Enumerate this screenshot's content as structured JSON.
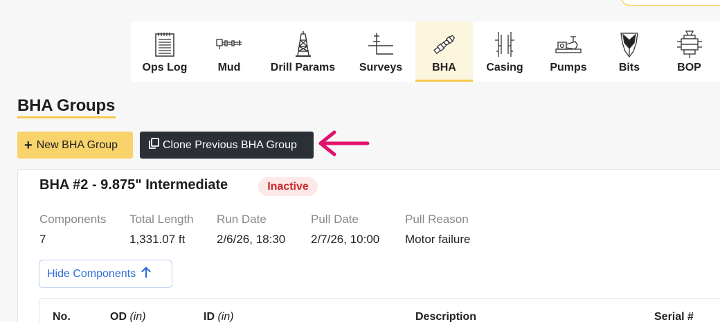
{
  "tabs": [
    {
      "label": "Ops Log",
      "icon": "ops-log-icon"
    },
    {
      "label": "Mud",
      "icon": "mud-icon"
    },
    {
      "label": "Drill Params",
      "icon": "drill-rig-icon"
    },
    {
      "label": "Surveys",
      "icon": "survey-icon"
    },
    {
      "label": "BHA",
      "icon": "bha-icon",
      "active": true
    },
    {
      "label": "Casing",
      "icon": "casing-icon"
    },
    {
      "label": "Pumps",
      "icon": "pump-icon"
    },
    {
      "label": "Bits",
      "icon": "bit-icon"
    },
    {
      "label": "BOP",
      "icon": "bop-icon"
    }
  ],
  "section": {
    "title": "BHA Groups"
  },
  "actions": {
    "new_label": "New BHA Group",
    "clone_label": "Clone Previous BHA Group"
  },
  "bha": {
    "title": "BHA #2 - 9.875\" Intermediate",
    "status": "Inactive",
    "meta": [
      {
        "label": "Components",
        "value": "7"
      },
      {
        "label": "Total Length",
        "value": "1,331.07 ft"
      },
      {
        "label": "Run Date",
        "value": "2/6/26, 18:30"
      },
      {
        "label": "Pull Date",
        "value": "2/7/26, 10:00"
      },
      {
        "label": "Pull Reason",
        "value": "Motor failure"
      }
    ],
    "hide_label": "Hide Components"
  },
  "table": {
    "headers": [
      {
        "label": "No.",
        "unit": ""
      },
      {
        "label": "OD",
        "unit": "(in)"
      },
      {
        "label": "ID",
        "unit": "(in)"
      },
      {
        "label": "Description",
        "unit": ""
      },
      {
        "label": "Serial #",
        "unit": ""
      }
    ]
  },
  "colors": {
    "accent": "#f6c94d",
    "danger": "#c6282b",
    "link": "#2f6ed8",
    "dark": "#2b2f36",
    "pointer_arrow": "#e0126a"
  }
}
